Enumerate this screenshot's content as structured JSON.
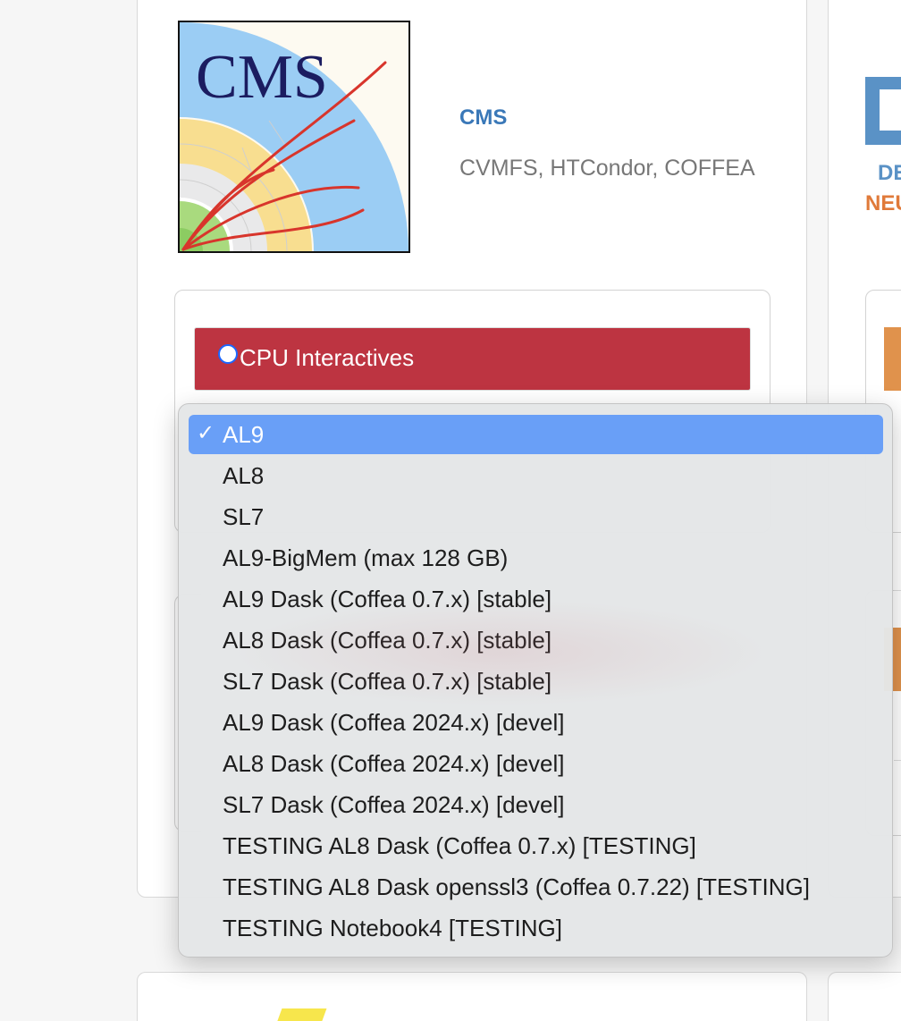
{
  "experiment": {
    "name": "CMS",
    "description": "CVMFS, HTCondor, COFFEA",
    "logo_text": "CMS"
  },
  "option": {
    "label": "CPU Interactives",
    "color": "#bd3441"
  },
  "dropdown": {
    "selected_index": 0,
    "items": [
      "AL9",
      "AL8",
      "SL7",
      "AL9-BigMem (max 128 GB)",
      "AL9 Dask (Coffea 0.7.x) [stable]",
      "AL8 Dask (Coffea 0.7.x) [stable]",
      "SL7 Dask (Coffea 0.7.x) [stable]",
      "AL9 Dask (Coffea 2024.x) [devel]",
      "AL8 Dask (Coffea 2024.x) [devel]",
      "SL7 Dask (Coffea 2024.x) [devel]",
      "TESTING AL8 Dask (Coffea 0.7.x) [TESTING]",
      "TESTING AL8 Dask openssl3 (Coffea 0.7.22) [TESTING]",
      "TESTING Notebook4 [TESTING]"
    ],
    "check_glyph": "✓",
    "highlight_color": "#699ff7"
  },
  "side_card": {
    "text1": "DE",
    "text2": "NEU"
  }
}
